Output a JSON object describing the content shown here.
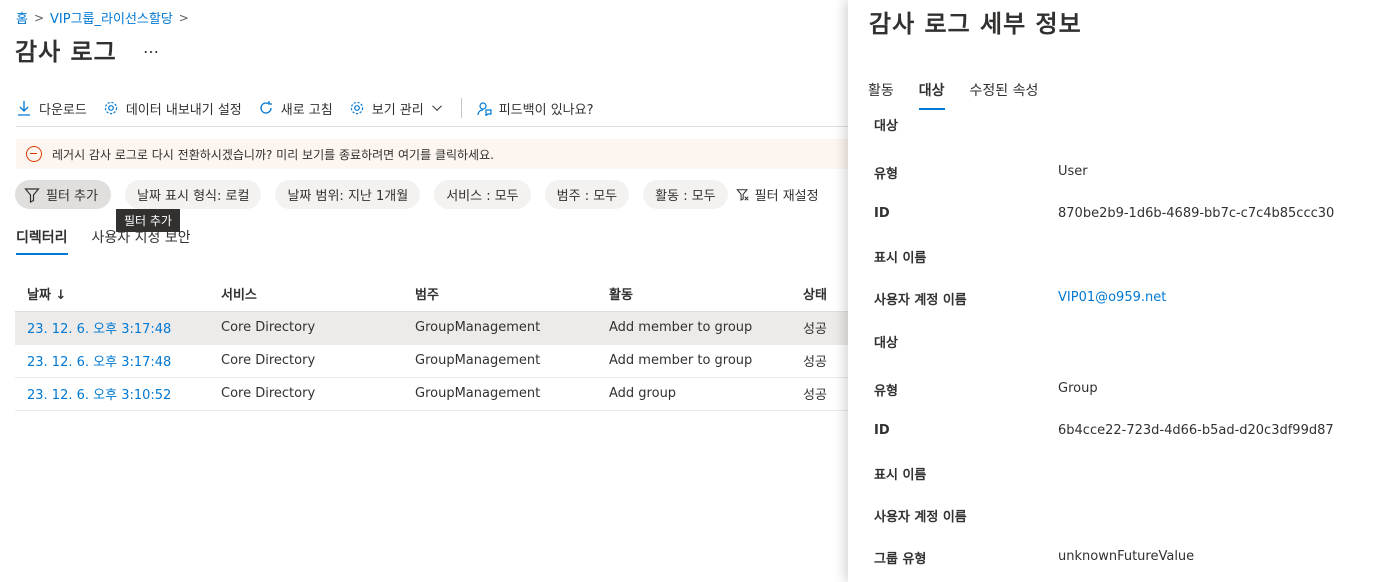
{
  "breadcrumb": {
    "home": "홈",
    "group": "VIP그룹_라이선스할당"
  },
  "page": {
    "title": "감사 로그",
    "more": "…"
  },
  "toolbar": {
    "download": "다운로드",
    "export_settings": "데이터 내보내기 설정",
    "refresh": "새로 고침",
    "manage_view": "보기 관리",
    "feedback": "피드백이 있나요?"
  },
  "banner": {
    "text": "레거시 감사 로그로 다시 전환하시겠습니까? 미리 보기를 종료하려면 여기를 클릭하세요."
  },
  "filters": {
    "add": "필터 추가",
    "date_format": "날짜 표시 형식: 로컬",
    "date_range": "날짜 범위: 지난 1개월",
    "service": "서비스 : 모두",
    "category": "범주 : 모두",
    "activity": "활동 : 모두",
    "reset": "필터 재설정",
    "tooltip": "필터 추가"
  },
  "subtabs": {
    "directory": "디렉터리",
    "custom_security": "사용자 지정 보안"
  },
  "table": {
    "headers": {
      "date": "날짜 ↓",
      "service": "서비스",
      "category": "범주",
      "activity": "활동",
      "status": "상태"
    },
    "rows": [
      {
        "date": "23. 12. 6. 오후 3:17:48",
        "service": "Core Directory",
        "category": "GroupManagement",
        "activity": "Add member to group",
        "status": "성공"
      },
      {
        "date": "23. 12. 6. 오후 3:17:48",
        "service": "Core Directory",
        "category": "GroupManagement",
        "activity": "Add member to group",
        "status": "성공"
      },
      {
        "date": "23. 12. 6. 오후 3:10:52",
        "service": "Core Directory",
        "category": "GroupManagement",
        "activity": "Add group",
        "status": "성공"
      }
    ]
  },
  "details": {
    "title": "감사 로그 세부 정보",
    "tabs": {
      "activity": "활동",
      "target": "대상",
      "modified": "수정된 속성"
    },
    "target1": {
      "heading": "대상",
      "type_label": "유형",
      "type_value": "User",
      "id_label": "ID",
      "id_value": "870be2b9-1d6b-4689-bb7c-c7c4b85ccc30",
      "display_label": "표시 이름",
      "upn_label": "사용자 계정 이름",
      "upn_value": "VIP01@o959.net"
    },
    "target2": {
      "heading": "대상",
      "type_label": "유형",
      "type_value": "Group",
      "id_label": "ID",
      "id_value": "6b4cce22-723d-4d66-b5ad-d20c3df99d87",
      "display_label": "표시 이름",
      "upn_label": "사용자 계정 이름",
      "group_type_label": "그룹 유형",
      "group_type_value": "unknownFutureValue"
    }
  },
  "colors": {
    "accent": "#0078d4",
    "warning": "#d83b01",
    "banner_bg": "#fdf6f0"
  }
}
